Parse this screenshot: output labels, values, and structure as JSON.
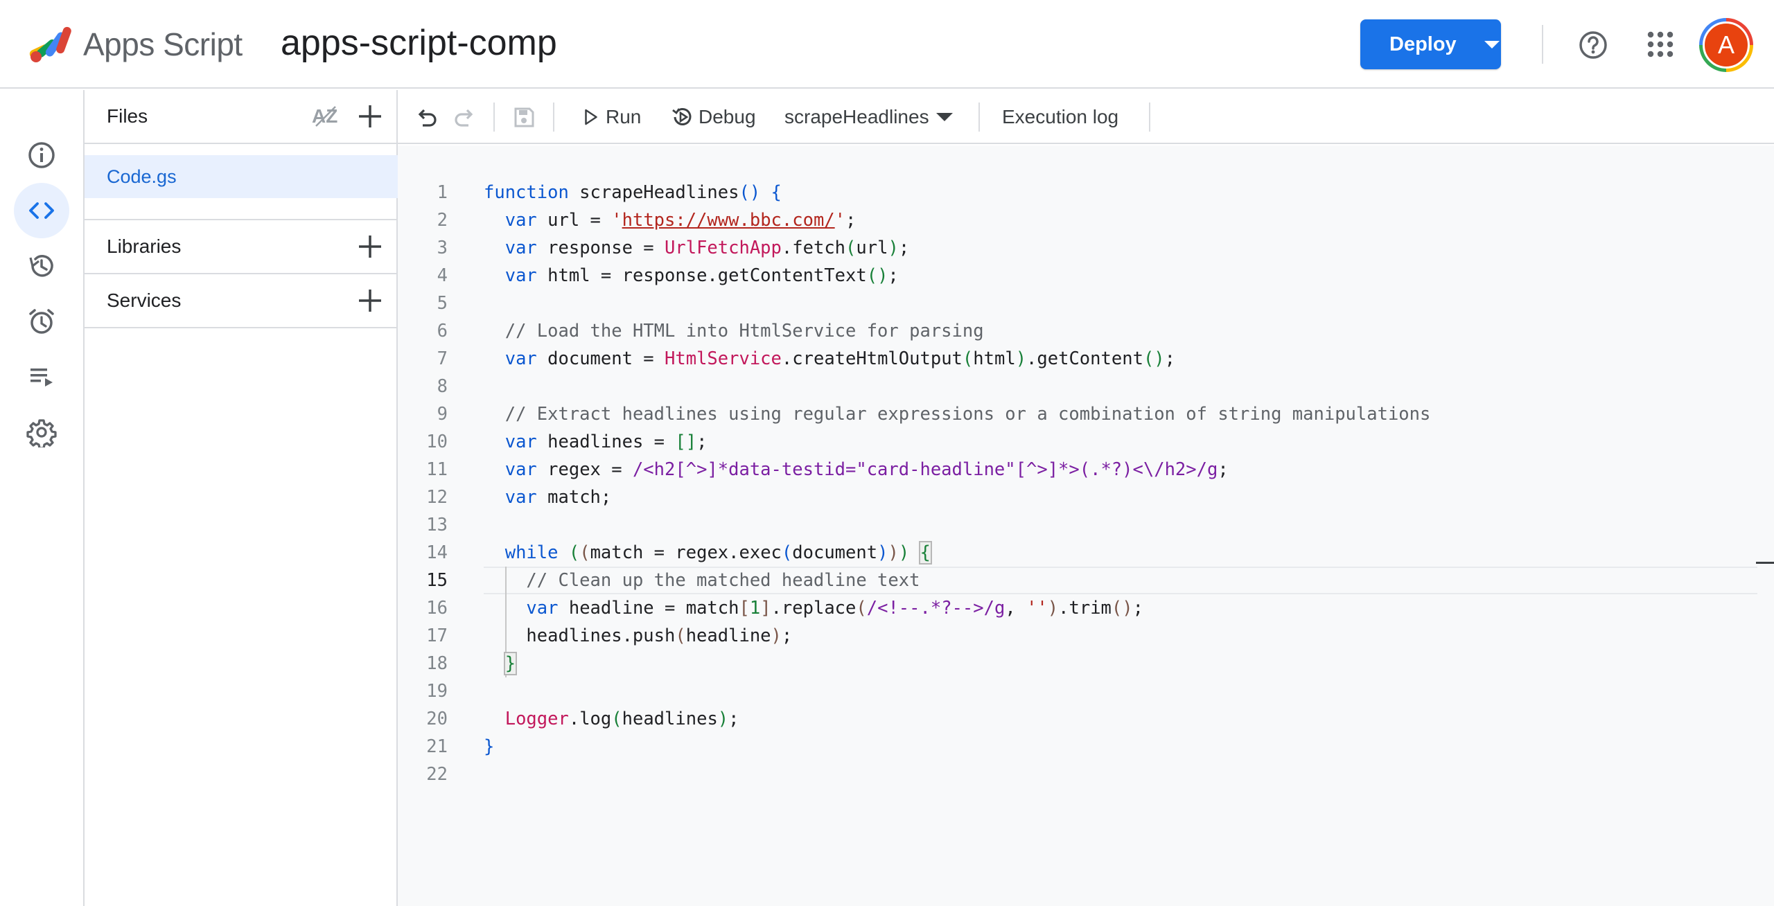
{
  "header": {
    "app_name": "Apps Script",
    "project_title": "apps-script-comp",
    "deploy_label": "Deploy",
    "avatar_initial": "A",
    "accent_color": "#1a73e8"
  },
  "rail": {
    "items": [
      {
        "name": "overview",
        "icon": "info-icon",
        "active": false
      },
      {
        "name": "editor",
        "icon": "code-icon",
        "active": true
      },
      {
        "name": "project-history",
        "icon": "history-icon",
        "active": false
      },
      {
        "name": "triggers",
        "icon": "alarm-icon",
        "active": false
      },
      {
        "name": "executions",
        "icon": "executions-icon",
        "active": false
      },
      {
        "name": "settings",
        "icon": "gear-icon",
        "active": false
      }
    ]
  },
  "files_panel": {
    "files_title": "Files",
    "sort_label": "AZ",
    "files": [
      "Code.gs"
    ],
    "libraries_title": "Libraries",
    "services_title": "Services"
  },
  "toolbar": {
    "run_label": "Run",
    "debug_label": "Debug",
    "function_select": "scrapeHeadlines",
    "execution_log_label": "Execution log"
  },
  "editor": {
    "current_line": 15,
    "line_numbers": [
      "1",
      "2",
      "3",
      "4",
      "5",
      "6",
      "7",
      "8",
      "9",
      "10",
      "11",
      "12",
      "13",
      "14",
      "15",
      "16",
      "17",
      "18",
      "19",
      "20",
      "21",
      "22"
    ],
    "lines": [
      "function scrapeHeadlines() {",
      "  var url = 'https://www.bbc.com/';",
      "  var response = UrlFetchApp.fetch(url);",
      "  var html = response.getContentText();",
      "",
      "  // Load the HTML into HtmlService for parsing",
      "  var document = HtmlService.createHtmlOutput(html).getContent();",
      "",
      "  // Extract headlines using regular expressions or a combination of string manipulations",
      "  var headlines = [];",
      "  var regex = /<h2[^>]*data-testid=\"card-headline\"[^>]*>(.*?)<\\/h2>/g;",
      "  var match;",
      "",
      "  while ((match = regex.exec(document))) {",
      "    // Clean up the matched headline text",
      "    var headline = match[1].replace(/<!--.*?-->/g, '').trim();",
      "    headlines.push(headline);",
      "  }",
      "",
      "  Logger.log(headlines);",
      "}",
      ""
    ]
  }
}
